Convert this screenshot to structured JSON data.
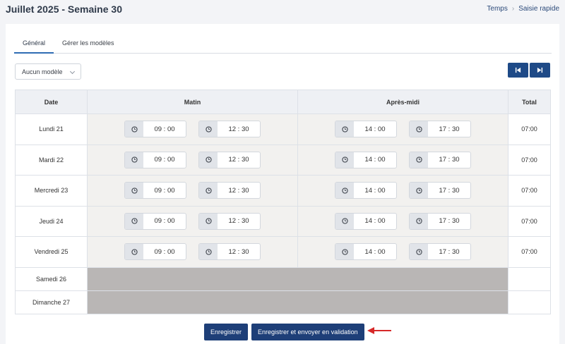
{
  "header": {
    "title": "Juillet 2025 - Semaine 30",
    "breadcrumb": [
      "Temps",
      "Saisie rapide"
    ]
  },
  "tabs": [
    {
      "label": "Général",
      "active": true
    },
    {
      "label": "Gérer les modèles",
      "active": false
    }
  ],
  "model_select": {
    "value": "Aucun modèle"
  },
  "table": {
    "headers": {
      "date": "Date",
      "morning": "Matin",
      "afternoon": "Après-midi",
      "total": "Total"
    },
    "rows": [
      {
        "date": "Lundi 21",
        "m_start": "09 : 00",
        "m_end": "12 : 30",
        "a_start": "14 : 00",
        "a_end": "17 : 30",
        "total": "07:00"
      },
      {
        "date": "Mardi 22",
        "m_start": "09 : 00",
        "m_end": "12 : 30",
        "a_start": "14 : 00",
        "a_end": "17 : 30",
        "total": "07:00"
      },
      {
        "date": "Mercredi 23",
        "m_start": "09 : 00",
        "m_end": "12 : 30",
        "a_start": "14 : 00",
        "a_end": "17 : 30",
        "total": "07:00"
      },
      {
        "date": "Jeudi 24",
        "m_start": "09 : 00",
        "m_end": "12 : 30",
        "a_start": "14 : 00",
        "a_end": "17 : 30",
        "total": "07:00"
      },
      {
        "date": "Vendredi 25",
        "m_start": "09 : 00",
        "m_end": "12 : 30",
        "a_start": "14 : 00",
        "a_end": "17 : 30",
        "total": "07:00"
      }
    ],
    "weekend": [
      {
        "date": "Samedi 26"
      },
      {
        "date": "Dimanche 27"
      }
    ]
  },
  "buttons": {
    "save": "Enregistrer",
    "save_submit": "Enregistrer et envoyer en validation"
  },
  "icons": {
    "nav_first": "skip-back-icon",
    "nav_last": "skip-forward-icon",
    "clock": "clock-icon",
    "annotation_arrow": "red-arrow-icon"
  },
  "colors": {
    "primary": "#1e3f78",
    "tab_active": "#2f6cb3",
    "weekend_fill": "#b9b6b5",
    "arrow": "#d62828"
  }
}
